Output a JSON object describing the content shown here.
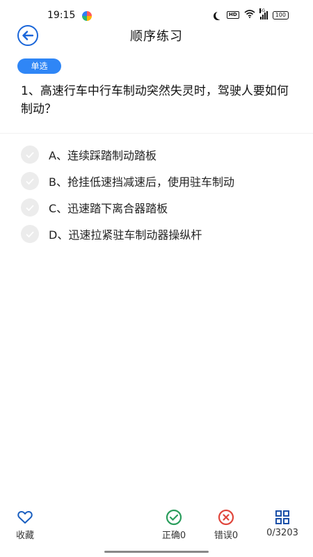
{
  "status": {
    "time": "19:15",
    "hd": "HD",
    "wifi_icon": "wifi-icon",
    "signal_label": "5G",
    "battery": "100"
  },
  "header": {
    "title": "顺序练习",
    "back_icon": "back-arrow-icon"
  },
  "question": {
    "type_label": "单选",
    "text": "1、高速行车中行车制动突然失灵时，驾驶人要如何制动？",
    "options": [
      {
        "label": "A、连续踩踏制动踏板"
      },
      {
        "label": "B、抢挂低速挡减速后，使用驻车制动"
      },
      {
        "label": "C、迅速踏下离合器踏板"
      },
      {
        "label": "D、迅速拉紧驻车制动器操纵杆"
      }
    ]
  },
  "bottom_bar": {
    "favorite_label": "收藏",
    "correct_label": "正确0",
    "wrong_label": "错误0",
    "progress_label": "0/3203"
  },
  "colors": {
    "accent": "#1a66d9",
    "badge": "#2f86f6",
    "correct": "#2a9d5c",
    "wrong": "#e0463c",
    "favorite": "#1a5fc0",
    "grid": "#1a4fa8"
  }
}
